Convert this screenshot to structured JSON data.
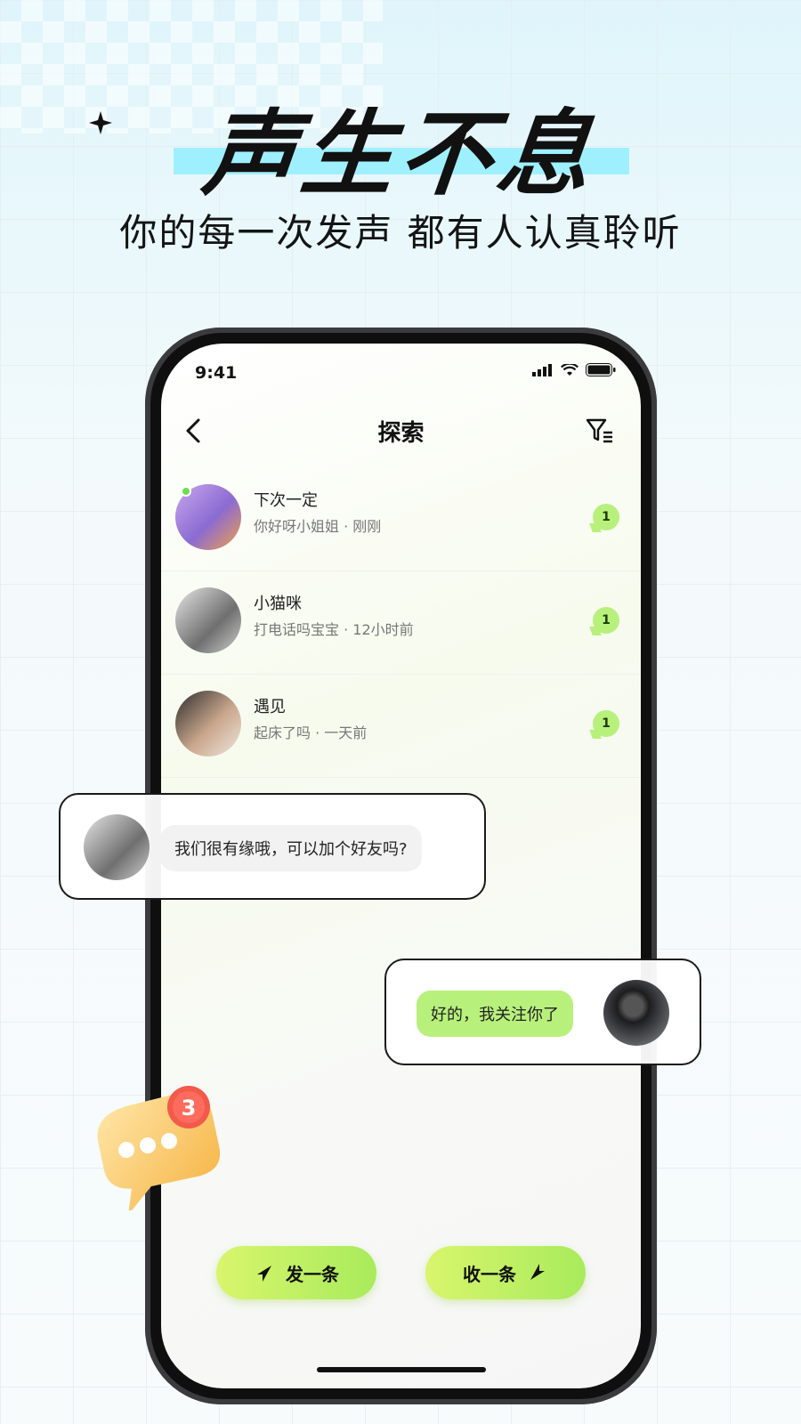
{
  "hero": {
    "title": "声生不息",
    "subtitle": "你的每一次发声 都有人认真聆听"
  },
  "status": {
    "time": "9:41"
  },
  "nav": {
    "title": "探索"
  },
  "messages": [
    {
      "name": "下次一定",
      "preview": "你好呀小姐姐 · 刚刚",
      "unread": "1",
      "online": true
    },
    {
      "name": "小猫咪",
      "preview": "打电话吗宝宝 · 12小时前",
      "unread": "1",
      "online": false
    },
    {
      "name": "遇见",
      "preview": "起床了吗 · 一天前",
      "unread": "1",
      "online": false
    }
  ],
  "chat_incoming": {
    "text": "我们很有缘哦，可以加个好友吗?"
  },
  "chat_outgoing": {
    "text": "好的，我关注你了"
  },
  "actions": {
    "send_label": "发一条",
    "receive_label": "收一条"
  },
  "float_badge": {
    "count": "3"
  },
  "colors": {
    "accent_green": "#b8f07c",
    "highlight_cyan": "#9ff0ff"
  }
}
